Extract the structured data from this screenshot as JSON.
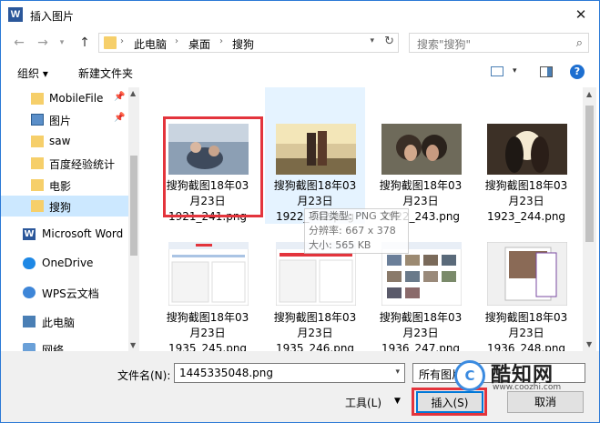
{
  "window": {
    "title": "插入图片",
    "app_icon": "W"
  },
  "address": {
    "parts": [
      "此电脑",
      "桌面",
      "搜狗"
    ]
  },
  "search": {
    "placeholder": "搜索\"搜狗\""
  },
  "toolbar": {
    "organize": "组织 ▾",
    "new_folder": "新建文件夹"
  },
  "sidebar": {
    "items": [
      {
        "label": "MobileFile",
        "icon": "folder-icon",
        "pinned": true
      },
      {
        "label": "图片",
        "icon": "pictures-icon",
        "pinned": true
      },
      {
        "label": "saw",
        "icon": "folder-icon"
      },
      {
        "label": "百度经验统计",
        "icon": "folder-icon"
      },
      {
        "label": "电影",
        "icon": "folder-icon"
      },
      {
        "label": "搜狗",
        "icon": "folder-icon",
        "selected": true
      },
      {
        "label": "Microsoft Word",
        "icon": "word-icon"
      },
      {
        "label": "OneDrive",
        "icon": "cloud-icon"
      },
      {
        "label": "WPS云文档",
        "icon": "wps-cloud-icon"
      },
      {
        "label": "此电脑",
        "icon": "computer-icon"
      },
      {
        "label": "网络",
        "icon": "network-icon"
      }
    ]
  },
  "files": [
    {
      "line1": "搜狗截图18年03",
      "line2": "月23日",
      "line3": "1921_241.png"
    },
    {
      "line1": "搜狗截图18年03",
      "line2": "月23日",
      "line3": "1922_242.png"
    },
    {
      "line1": "搜狗截图18年03",
      "line2": "月23日",
      "line3": "1922_243.png"
    },
    {
      "line1": "搜狗截图18年03",
      "line2": "月23日",
      "line3": "1923_244.png"
    },
    {
      "line1": "搜狗截图18年03",
      "line2": "月23日",
      "line3": "1935_245.png"
    },
    {
      "line1": "搜狗截图18年03",
      "line2": "月23日",
      "line3": "1935_246.png"
    },
    {
      "line1": "搜狗截图18年03",
      "line2": "月23日",
      "line3": "1936_247.png"
    },
    {
      "line1": "搜狗截图18年03",
      "line2": "月23日",
      "line3": "1936_248.png"
    }
  ],
  "tooltip": {
    "type": "项目类型: PNG 文件",
    "dims": "分辨率: 667 x 378",
    "size": "大小: 565 KB"
  },
  "bottom": {
    "filename_label": "文件名(N):",
    "filename_value": "1445335048.png",
    "filetype_value": "所有图片",
    "tools_label": "工具(L)",
    "insert_label": "插入(S)",
    "cancel_label": "取消"
  },
  "watermark": {
    "logo": "C",
    "text": "酷知网",
    "url": "www.coozhi.com"
  }
}
